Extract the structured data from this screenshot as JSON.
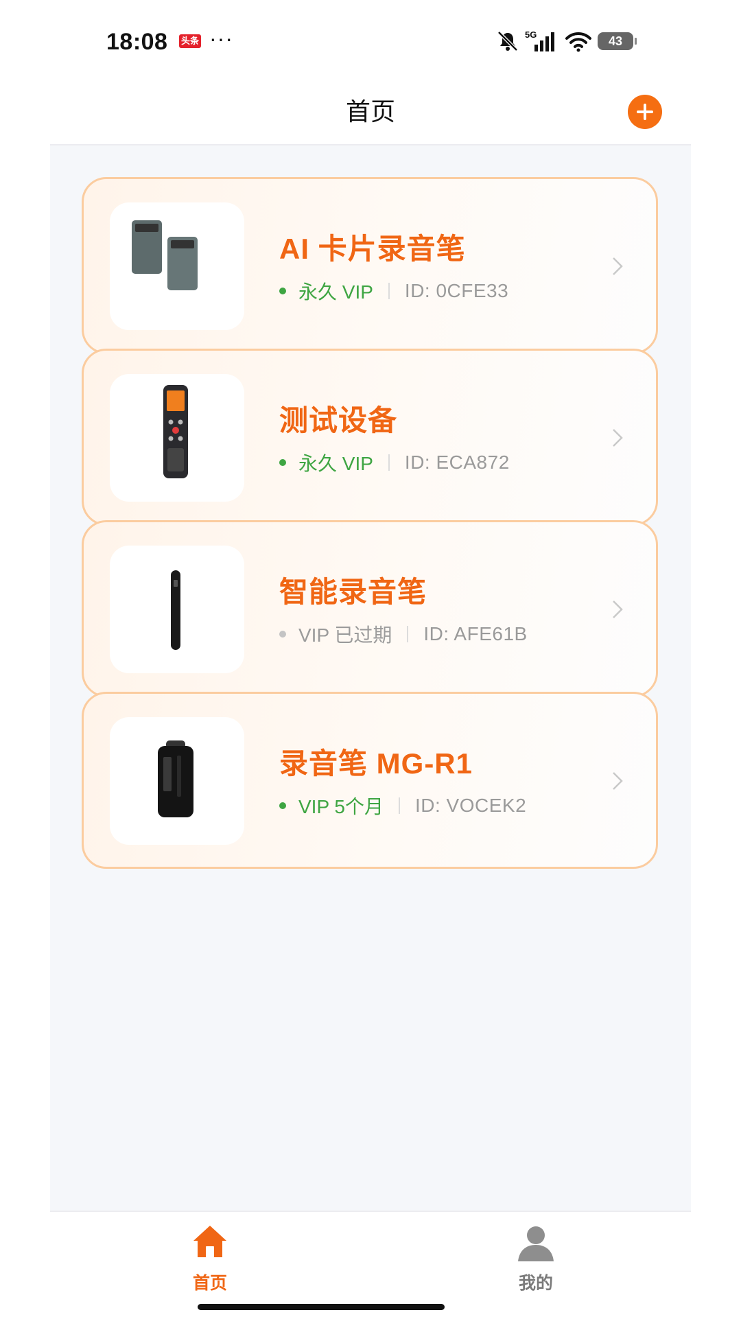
{
  "status_bar": {
    "time": "18:08",
    "news_badge": "头条",
    "more": "···",
    "network": "5G",
    "battery": "43"
  },
  "header": {
    "title": "首页"
  },
  "devices": [
    {
      "name": "AI 卡片录音笔",
      "vip": "永久 VIP",
      "vip_active": true,
      "id": "ID: 0CFE33",
      "image_icon": "card-recorder-image"
    },
    {
      "name": "测试设备",
      "vip": "永久 VIP",
      "vip_active": true,
      "id": "ID: ECA872",
      "image_icon": "voice-recorder-image"
    },
    {
      "name": "智能录音笔",
      "vip": "VIP 已过期",
      "vip_active": false,
      "id": "ID: AFE61B",
      "image_icon": "pen-recorder-image"
    },
    {
      "name": "录音笔 MG-R1",
      "vip": "VIP 5个月",
      "vip_active": true,
      "id": "ID: VOCEK2",
      "image_icon": "clip-recorder-image"
    }
  ],
  "colors": {
    "accent": "#f06614",
    "vip_active": "#3ea542",
    "vip_expired": "#9b9b9b",
    "card_border": "#fbcc9f",
    "background": "#f5f7fa"
  },
  "tab_bar": [
    {
      "label": "首页",
      "icon": "home-icon",
      "active": true
    },
    {
      "label": "我的",
      "icon": "user-icon",
      "active": false
    }
  ]
}
